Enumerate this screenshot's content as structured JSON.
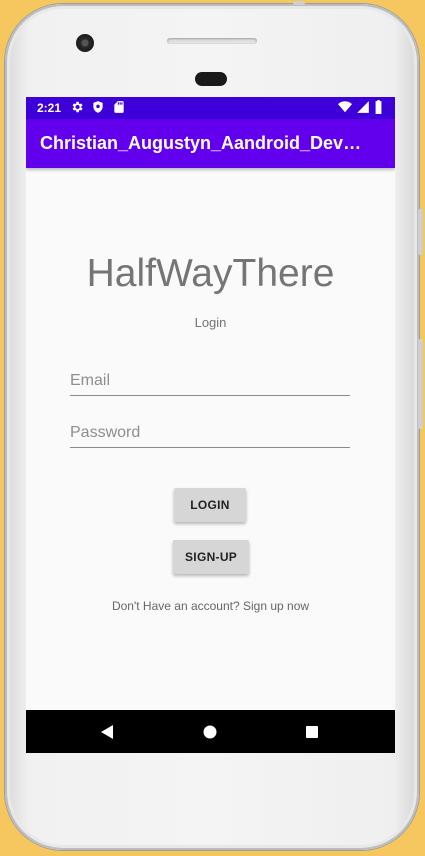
{
  "status_bar": {
    "time": "2:21",
    "background": "#3d00d8",
    "left_icons": [
      "gear-icon",
      "shield-icon",
      "sd-card-icon"
    ],
    "right_icons": [
      "wifi-icon",
      "signal-icon",
      "battery-icon"
    ]
  },
  "app_bar": {
    "title": "Christian_Augustyn_Aandroid_Develop...",
    "background": "#6200ee"
  },
  "main": {
    "app_name": "HalfWayThere",
    "subtitle": "Login",
    "email_placeholder": "Email",
    "password_placeholder": "Password",
    "login_label": "LOGIN",
    "signup_label": "SIGN-UP",
    "signup_link": "Don't Have an account? Sign up now"
  },
  "nav_bar": {
    "icons": [
      "back-icon",
      "home-icon",
      "recents-icon"
    ]
  }
}
